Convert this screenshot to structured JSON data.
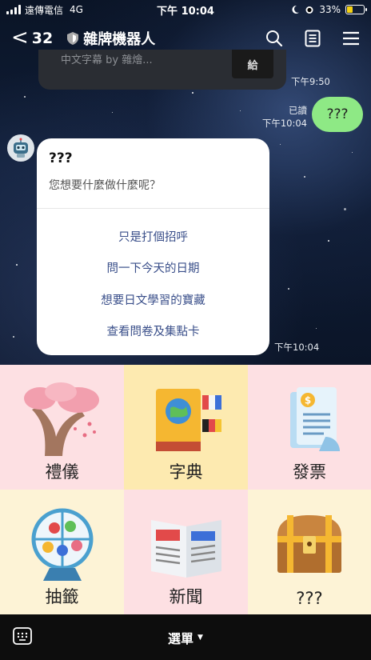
{
  "status": {
    "carrier": "遠傳電信",
    "network": "4G",
    "time": "下午 10:04",
    "battery_percent": "33%",
    "battery_level": 0.33
  },
  "header": {
    "back_count": "32",
    "title": "雜牌機器人",
    "icons": [
      "search-icon",
      "notes-icon",
      "menu-icon"
    ]
  },
  "messages": {
    "prev_card_text": "中文字幕 by 雜燴...",
    "prev_thumb_text": "給",
    "prev_time": "下午9:50",
    "sent_text": "???",
    "read_label": "已讀",
    "sent_time": "下午10:04",
    "bot_card": {
      "title": "???",
      "subtitle": "您想要什麼做什麼呢？",
      "actions": [
        "只是打個招呼",
        "問一下今天的日期",
        "想要日文學習的寶藏",
        "查看問卷及集點卡"
      ],
      "time": "下午10:04"
    }
  },
  "rich_menu": {
    "tiles": [
      {
        "label": "禮儀",
        "bg": "#fde0e3"
      },
      {
        "label": "字典",
        "bg": "#fdeab0"
      },
      {
        "label": "發票",
        "bg": "#fde0e3"
      },
      {
        "label": "抽籤",
        "bg": "#fdf3d6"
      },
      {
        "label": "新聞",
        "bg": "#fde0e3"
      },
      {
        "label": "???",
        "bg": "#fdf3d6"
      }
    ]
  },
  "bottom_bar": {
    "menu_label": "選單"
  }
}
